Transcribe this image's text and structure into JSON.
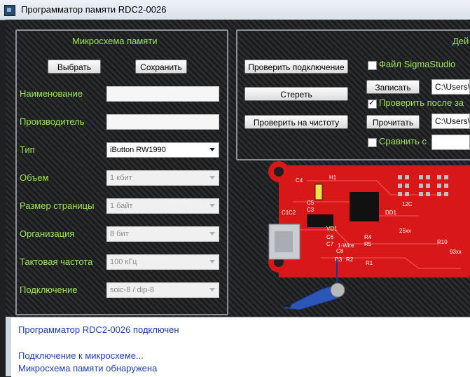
{
  "window": {
    "title": "Программатор памяти RDC2-0026"
  },
  "left_panel": {
    "title": "Микросхема памяти",
    "select_label": "Выбрать",
    "save_label": "Сохранить",
    "fields": {
      "name_label": "Наименование",
      "manufacturer_label": "Производитель",
      "type_label": "Тип",
      "type_value": "iButton RW1990",
      "size_label": "Объем",
      "size_value": "1 кбит",
      "page_label": "Размер страницы",
      "page_value": "1 байт",
      "org_label": "Организация",
      "org_value": "8 бит",
      "clock_label": "Тактовая частота",
      "clock_value": "100 кГц",
      "conn_label": "Подключение",
      "conn_value": "soic-8 / dip-8"
    }
  },
  "right_panel": {
    "title": "Дей",
    "check_conn_label": "Проверить подключение",
    "erase_label": "Стереть",
    "blank_check_label": "Проверить на чистоту",
    "sigma_label": "Файл SigmaStudio",
    "sigma_checked": false,
    "write_label": "Записать",
    "write_path": "C:\\Users\\",
    "verify_label": "Проверить после за",
    "verify_checked": true,
    "read_label": "Прочитать",
    "read_path": "C:\\Users\\",
    "compare_label": "Сравнить с",
    "compare_checked": false
  },
  "board": {
    "labels": [
      "C4",
      "H1",
      "DD1",
      "25xx",
      "93xx",
      "12C",
      "R10",
      "VD1",
      "C6",
      "C7",
      "C8",
      "1-Wire",
      "R1",
      "R2",
      "R3",
      "R4",
      "R5",
      "C1",
      "C2",
      "C3",
      "C5"
    ]
  },
  "log": {
    "lines": [
      "Программатор RDC2-0026 подключен",
      "",
      "Подключение к микросхеме...",
      "Микросхема памяти обнаружена"
    ]
  },
  "colors": {
    "label_green": "#9ee65b",
    "log_blue": "#1f3fb5",
    "pcb_red": "#e01b1b"
  }
}
